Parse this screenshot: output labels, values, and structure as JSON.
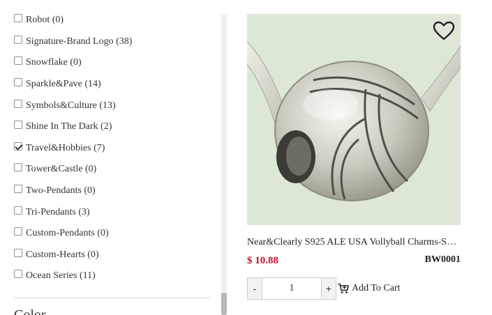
{
  "filters": [
    {
      "label": "Robot (0)",
      "checked": false
    },
    {
      "label": "Signature-Brand Logo (38)",
      "checked": false
    },
    {
      "label": "Snowflake (0)",
      "checked": false
    },
    {
      "label": "Sparkle&Pave (14)",
      "checked": false
    },
    {
      "label": "Symbols&Culture (13)",
      "checked": false
    },
    {
      "label": "Shine In The Dark (2)",
      "checked": false
    },
    {
      "label": "Travel&Hobbies (7)",
      "checked": true
    },
    {
      "label": "Tower&Castle (0)",
      "checked": false
    },
    {
      "label": "Two-Pendants (0)",
      "checked": false
    },
    {
      "label": "Tri-Pendants (3)",
      "checked": false
    },
    {
      "label": "Custom-Pendants (0)",
      "checked": false
    },
    {
      "label": "Custom-Hearts (0)",
      "checked": false
    },
    {
      "label": "Ocean Series (11)",
      "checked": false
    }
  ],
  "next_section_heading": "Color",
  "product": {
    "name": "Near&Clearly S925 ALE USA Vollyball Charms-S…",
    "price": "$ 10.88",
    "sku": "BW0001",
    "quantity": "1",
    "qty_minus": "-",
    "qty_plus": "+",
    "add_to_cart": "Add To Cart",
    "wishlist_icon": "heart-outline-icon",
    "cart_icon": "cart-plus-icon"
  },
  "colors": {
    "price": "#c8102e",
    "image_bg": "#dde7d6"
  }
}
